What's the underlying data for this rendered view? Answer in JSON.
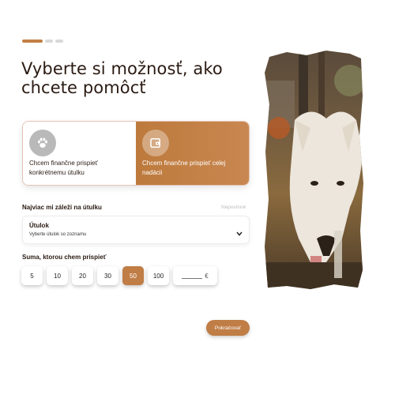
{
  "progress": {
    "steps_total": 3,
    "current_step": 1
  },
  "heading": "Vyberte si možnosť, ako chcete pomôcť",
  "options": [
    {
      "label": "Chcem finančne prispieť konkrétnemu útulku",
      "icon": "paw-icon",
      "selected": false
    },
    {
      "label": "Chcem finančne prispieť celej nadácii",
      "icon": "wallet-icon",
      "selected": true
    }
  ],
  "shelter": {
    "section_label": "Najviac mi záleží na útulku",
    "optional_hint": "Nepovinné",
    "select_title": "Útulok",
    "select_placeholder": "Vyberte útulok so zoznamu"
  },
  "amount": {
    "section_label": "Suma, ktorou chem prispieť",
    "values": [
      "5",
      "10",
      "20",
      "30",
      "50",
      "100"
    ],
    "selected": "50",
    "custom_currency": "€"
  },
  "continue_label": "Pokračovať",
  "colors": {
    "accent": "#c07d46",
    "text": "#2a1a12",
    "muted": "#bdbdbd"
  },
  "photo": {
    "subject": "white dog drinking"
  }
}
